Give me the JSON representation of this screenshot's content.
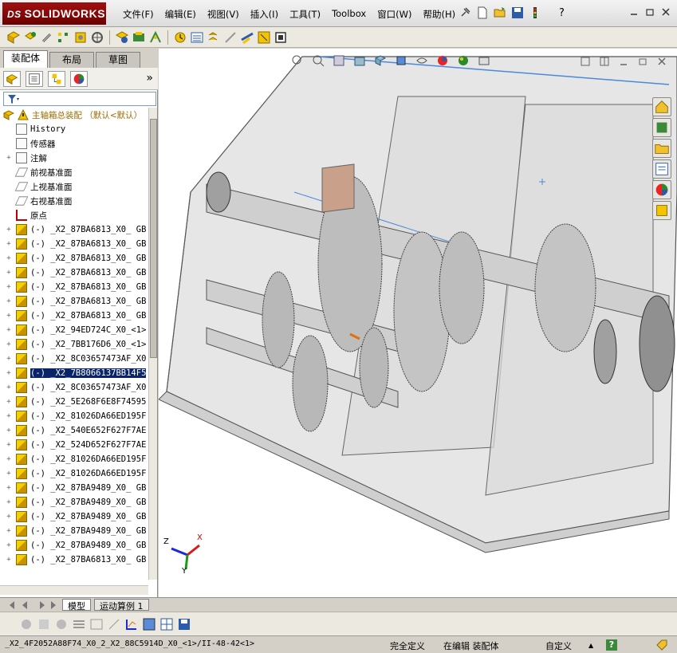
{
  "app": {
    "logo_ds": "DS",
    "logo_text": "SOLIDWORKS"
  },
  "menu": {
    "items": [
      "文件(F)",
      "编辑(E)",
      "视图(V)",
      "插入(I)",
      "工具(T)",
      "Toolbox",
      "窗口(W)",
      "帮助(H)"
    ]
  },
  "window": {
    "help": "?"
  },
  "panel": {
    "tabs": [
      "装配体",
      "布局",
      "草图"
    ],
    "expand_glyph": "»"
  },
  "tree": {
    "root": "主轴箱总装配 （默认<默认）",
    "items": [
      {
        "label": "History",
        "type": "feature"
      },
      {
        "label": "传感器",
        "type": "feature"
      },
      {
        "label": "注解",
        "type": "feature"
      },
      {
        "label": "前视基准面",
        "type": "plane"
      },
      {
        "label": "上视基准面",
        "type": "plane"
      },
      {
        "label": "右视基准面",
        "type": "plane"
      },
      {
        "label": "原点",
        "type": "origin"
      },
      {
        "label": "(-) _X2_87BA6813_X0_ GB",
        "type": "part"
      },
      {
        "label": "(-) _X2_87BA6813_X0_ GB",
        "type": "part"
      },
      {
        "label": "(-) _X2_87BA6813_X0_ GB",
        "type": "part"
      },
      {
        "label": "(-) _X2_87BA6813_X0_ GB",
        "type": "part"
      },
      {
        "label": "(-) _X2_87BA6813_X0_ GB",
        "type": "part"
      },
      {
        "label": "(-) _X2_87BA6813_X0_ GB",
        "type": "part"
      },
      {
        "label": "(-) _X2_87BA6813_X0_ GB",
        "type": "part"
      },
      {
        "label": "(-) _X2_94ED724C_X0_<1>",
        "type": "part"
      },
      {
        "label": "(-) _X2_7BB176D6_X0_<1>",
        "type": "part"
      },
      {
        "label": "(-) _X2_8C03657473AF_X0",
        "type": "part"
      },
      {
        "label": "(-) _X2_7B8066137BB14F5",
        "type": "part",
        "selected": true
      },
      {
        "label": "(-) _X2_8C03657473AF_X0",
        "type": "part"
      },
      {
        "label": "(-) _X2_5E268F6E8F74595",
        "type": "part"
      },
      {
        "label": "(-) _X2_81026DA66ED195F",
        "type": "part"
      },
      {
        "label": "(-) _X2_540E652F627F7AE",
        "type": "part"
      },
      {
        "label": "(-) _X2_524D652F627F7AE",
        "type": "part"
      },
      {
        "label": "(-) _X2_81026DA66ED195F",
        "type": "part"
      },
      {
        "label": "(-) _X2_81026DA66ED195F",
        "type": "part"
      },
      {
        "label": "(-) _X2_87BA9489_X0_ GB",
        "type": "part"
      },
      {
        "label": "(-) _X2_87BA9489_X0_ GB",
        "type": "part"
      },
      {
        "label": "(-) _X2_87BA9489_X0_ GB",
        "type": "part"
      },
      {
        "label": "(-) _X2_87BA9489_X0_ GB",
        "type": "part"
      },
      {
        "label": "(-) _X2_87BA9489_X0_ GB",
        "type": "part"
      },
      {
        "label": "(-) _X2_87BA6813_X0_ GB",
        "type": "part"
      }
    ]
  },
  "model_tabs": [
    "模型",
    "运动算例 1"
  ],
  "status": {
    "path": "_X2_4F2052A88F74_X0_2_X2_88C5914D_X0_<1>/II-48-42<1>",
    "definition": "完全定义",
    "mode": "在编辑 装配体",
    "custom": "自定义",
    "caret": "▲",
    "help": "?"
  },
  "triad": {
    "x": "X",
    "y": "Y",
    "z": "Z"
  },
  "colors": {
    "selection": "#0a246a",
    "logo": "#8b0000"
  }
}
